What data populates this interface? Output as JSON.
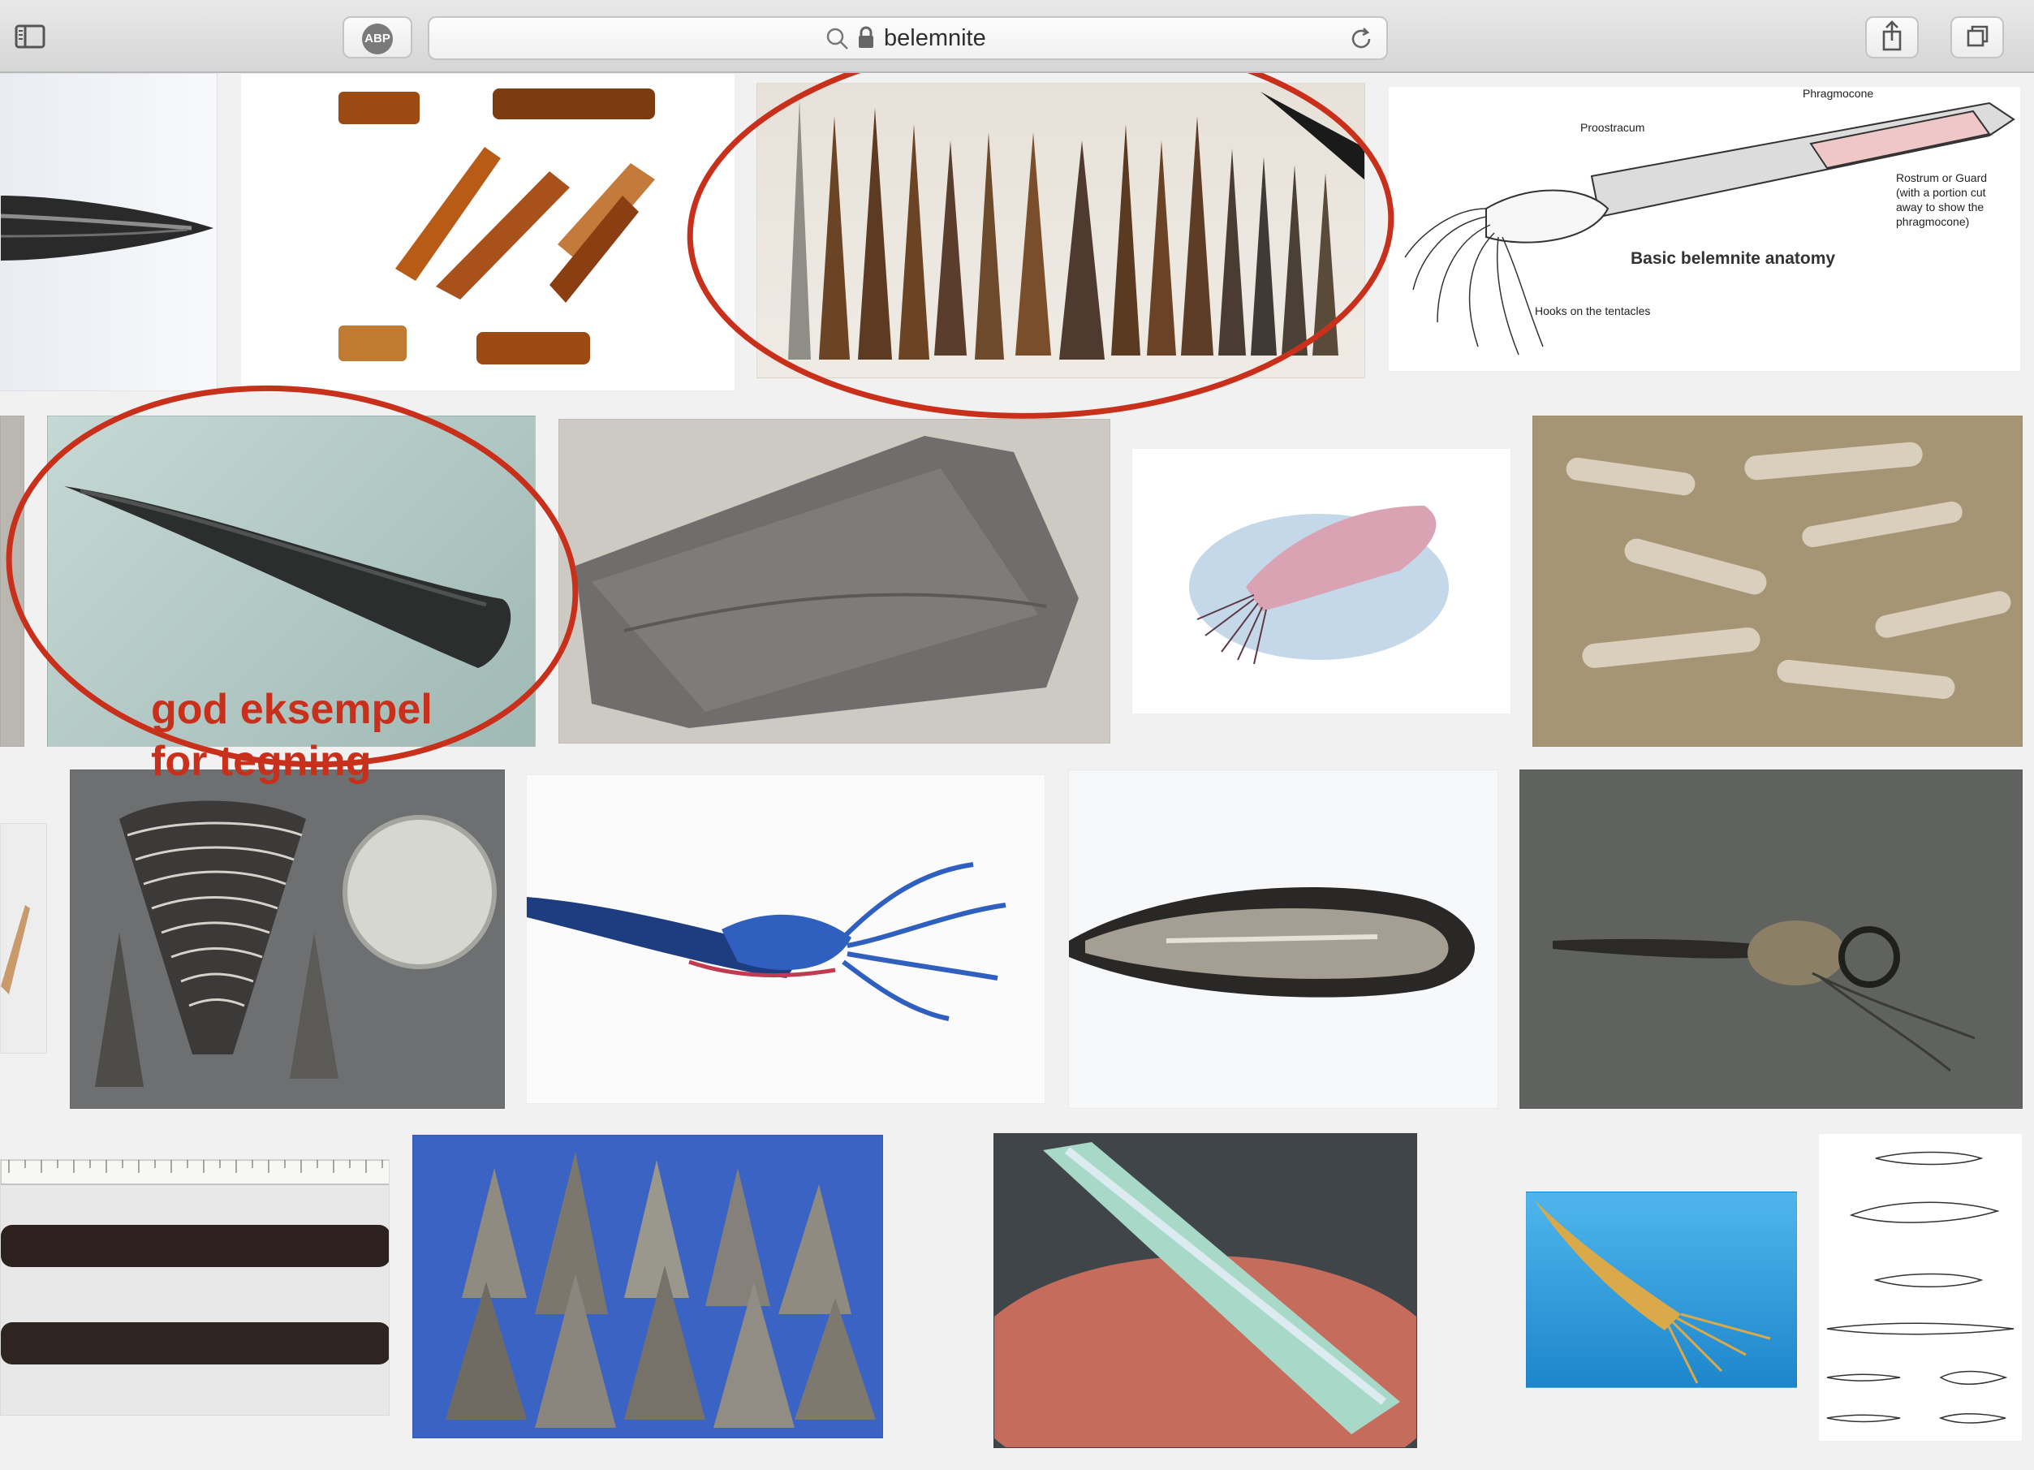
{
  "browser": {
    "adblock_label": "ABP",
    "address_text": "belemnite"
  },
  "annotation": {
    "line1": "god eksempel",
    "line2": "for tegning"
  },
  "anatomy_diagram": {
    "phragmocone": "Phragmocone",
    "proostracum": "Proostracum",
    "rostrum": "Rostrum or Guard",
    "rostrum_note_1": "(with a portion cut",
    "rostrum_note_2": "away to show the",
    "rostrum_note_3": "phragmocone)",
    "title": "Basic belemnite anatomy",
    "hooks": "Hooks on the tentacles"
  },
  "colors": {
    "annotation_red": "#c9301c",
    "toolbar_bg": "#dcdcdc",
    "page_bg": "#f1f1f1"
  },
  "icons": [
    "sidebar-icon",
    "search-icon",
    "lock-icon",
    "reload-icon",
    "share-icon",
    "tabs-icon"
  ]
}
